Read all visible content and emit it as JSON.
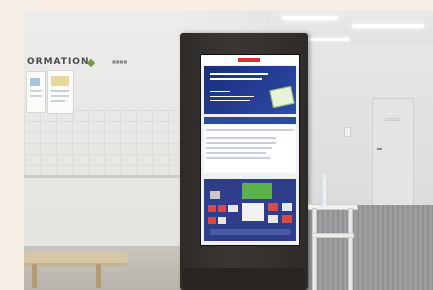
{
  "scene": {
    "wall_sign_text": "ORMATION",
    "wall_sign_subtext": "■■■■",
    "door_plate_text": "▭▭▭"
  },
  "colors": {
    "kiosk_frame": "#3b3734",
    "screen_banner": "#1a2f7a",
    "screen_logo": "#d8322e",
    "sign_accent": "#7a9a3c",
    "bench": "#d7c7a8"
  }
}
